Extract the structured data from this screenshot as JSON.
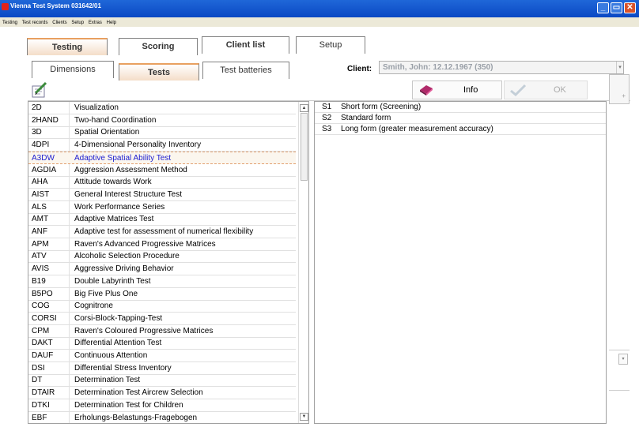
{
  "window": {
    "title": "Vienna Test System 031642/01",
    "controls": [
      "_",
      "▭",
      "✕"
    ]
  },
  "menu": [
    "Testing",
    "Test records",
    "Clients",
    "Setup",
    "Extras",
    "Help"
  ],
  "main_tabs": [
    "Testing",
    "Scoring",
    "Client list",
    "Setup"
  ],
  "sub_tabs": [
    "Dimensions",
    "Tests",
    "Test batteries"
  ],
  "client": {
    "label": "Client:",
    "value": "Smith, John: 12.12.1967 (350)"
  },
  "toolbar": {
    "info_label": "Info",
    "ok_label": "OK"
  },
  "tests": [
    {
      "code": "2D",
      "name": "Visualization"
    },
    {
      "code": "2HAND",
      "name": "Two-hand Coordination"
    },
    {
      "code": "3D",
      "name": "Spatial Orientation"
    },
    {
      "code": "4DPI",
      "name": "4-Dimensional Personality Inventory"
    },
    {
      "code": "A3DW",
      "name": "Adaptive Spatial Ability Test"
    },
    {
      "code": "AGDIA",
      "name": "Aggression Assessment Method"
    },
    {
      "code": "AHA",
      "name": "Attitude towards Work"
    },
    {
      "code": "AIST",
      "name": "General Interest Structure Test"
    },
    {
      "code": "ALS",
      "name": "Work Performance Series"
    },
    {
      "code": "AMT",
      "name": "Adaptive Matrices Test"
    },
    {
      "code": "ANF",
      "name": "Adaptive test for assessment of numerical flexibility"
    },
    {
      "code": "APM",
      "name": "Raven's Advanced Progressive Matrices"
    },
    {
      "code": "ATV",
      "name": "Alcoholic Selection Procedure"
    },
    {
      "code": "AVIS",
      "name": "Aggressive Driving Behavior"
    },
    {
      "code": "B19",
      "name": "Double Labyrinth Test"
    },
    {
      "code": "B5PO",
      "name": "Big Five Plus One"
    },
    {
      "code": "COG",
      "name": "Cognitrone"
    },
    {
      "code": "CORSI",
      "name": "Corsi-Block-Tapping-Test"
    },
    {
      "code": "CPM",
      "name": "Raven's Coloured Progressive Matrices"
    },
    {
      "code": "DAKT",
      "name": "Differential Attention Test"
    },
    {
      "code": "DAUF",
      "name": "Continuous Attention"
    },
    {
      "code": "DSI",
      "name": "Differential Stress Inventory"
    },
    {
      "code": "DT",
      "name": "Determination Test"
    },
    {
      "code": "DTAIR",
      "name": "Determination Test Aircrew Selection"
    },
    {
      "code": "DTKI",
      "name": "Determination Test for Children"
    },
    {
      "code": "EBF",
      "name": "Erholungs-Belastungs-Fragebogen"
    }
  ],
  "selected_test": "A3DW",
  "forms": [
    {
      "code": "S1",
      "name": "Short form (Screening)"
    },
    {
      "code": "S2",
      "name": "Standard form"
    },
    {
      "code": "S3",
      "name": "Long form (greater measurement accuracy)"
    }
  ],
  "colors": {
    "title_bar": "#0a48c4",
    "active_tab": "#f4ddc8",
    "selected_text": "#2020d0"
  }
}
